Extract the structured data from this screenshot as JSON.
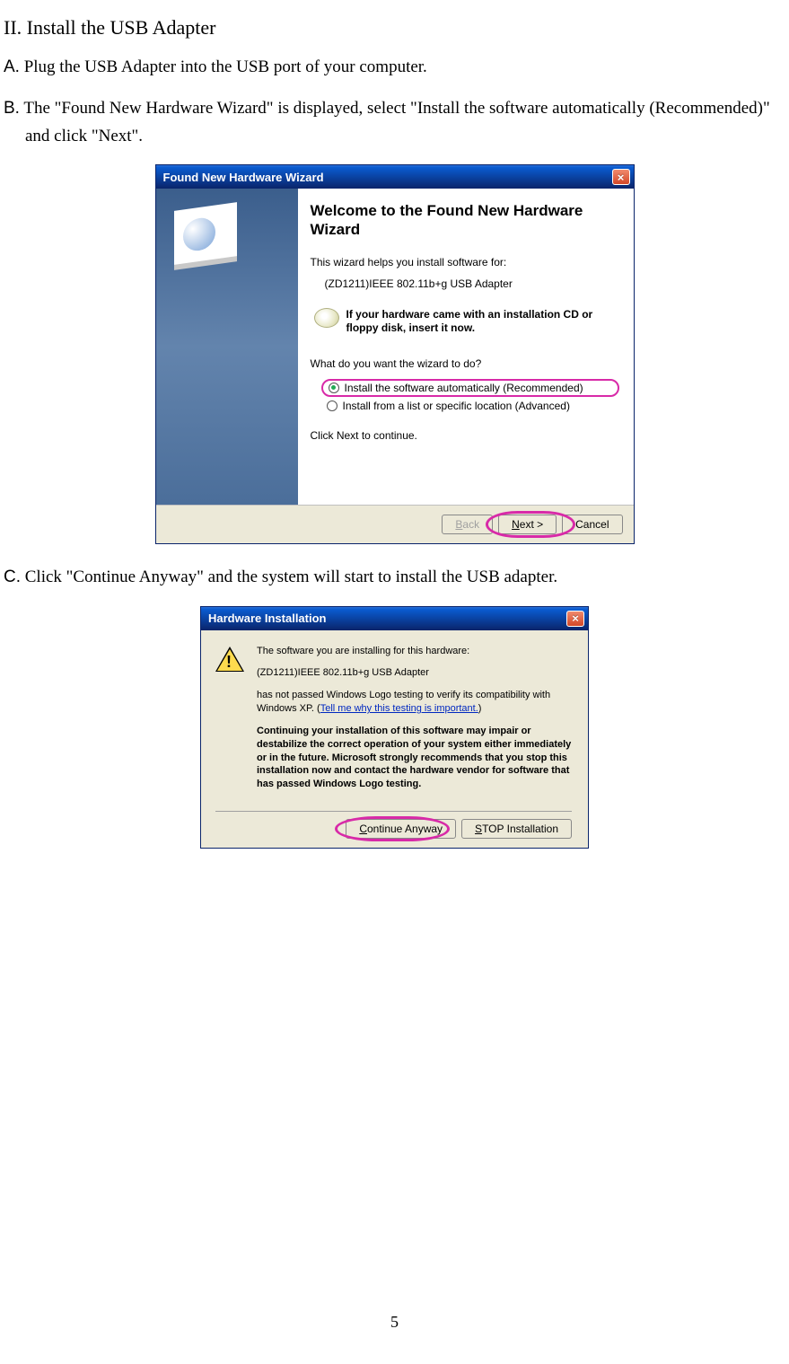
{
  "section_title": "II. Install the USB Adapter",
  "items": {
    "a": {
      "letter": "A.",
      "text": "Plug the USB Adapter into the USB port of your computer."
    },
    "b": {
      "letter": "B.",
      "text": "The \"Found New Hardware Wizard\" is displayed, select \"Install the software automatically (Recommended)\" and click \"Next\"."
    },
    "c": {
      "letter": "C.",
      "text": "Click \"Continue Anyway\" and the system will start to install the USB adapter."
    }
  },
  "wizard1": {
    "title": "Found New Hardware Wizard",
    "heading": "Welcome to the Found New Hardware Wizard",
    "intro": "This wizard helps you install software for:",
    "device": "(ZD1211)IEEE 802.11b+g USB Adapter",
    "cd_note": "If your hardware came with an installation CD or floppy disk, insert it now.",
    "question": "What do you want the wizard to do?",
    "opt1": "Install the software automatically (Recommended)",
    "opt2": "Install from a list or specific location (Advanced)",
    "click_next": "Click Next to continue.",
    "back": "< Back",
    "next": "Next >",
    "cancel": "Cancel"
  },
  "wizard2": {
    "title": "Hardware Installation",
    "line1": "The software you are installing for this hardware:",
    "device": "(ZD1211)IEEE 802.11b+g USB Adapter",
    "line2a": "has not passed Windows Logo testing to verify its compatibility with Windows XP. (",
    "link": "Tell me why this testing is important.",
    "line2b": ")",
    "warn": "Continuing your installation of this software may impair or destabilize the correct operation of your system either immediately or in the future. Microsoft strongly recommends that you stop this installation now and contact the hardware vendor for software that has passed Windows Logo testing.",
    "continue": "Continue Anyway",
    "stop": "STOP Installation"
  },
  "page_number": "5"
}
